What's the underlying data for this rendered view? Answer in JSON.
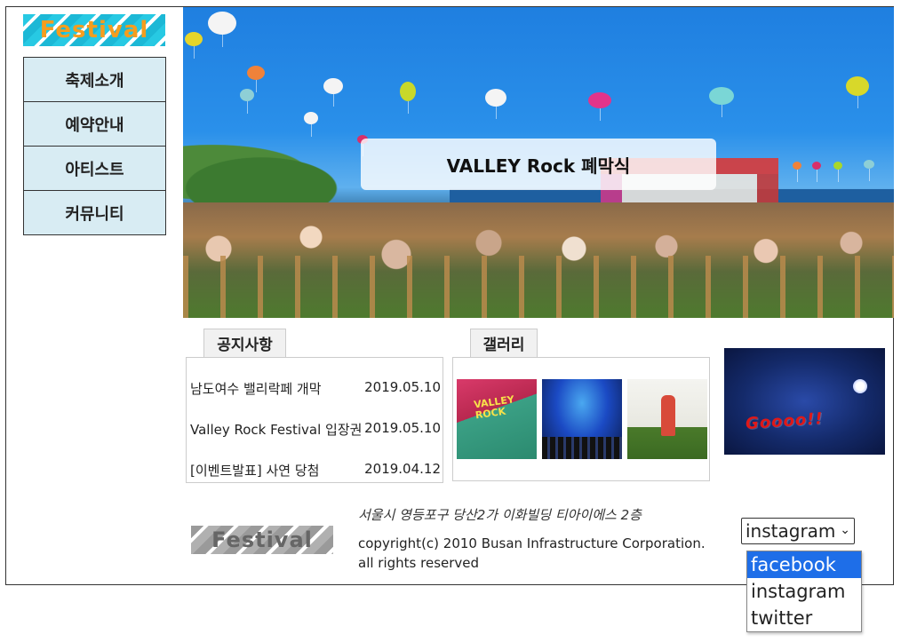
{
  "logo": {
    "text": "Festival"
  },
  "nav": {
    "items": [
      "축제소개",
      "예약안내",
      "아티스트",
      "커뮤니티"
    ]
  },
  "hero": {
    "title": "VALLEY Rock 폐막식"
  },
  "notice": {
    "tab_label": "공지사항",
    "items": [
      {
        "title": "남도여수 밸리락페 개막",
        "date": "2019.05.10"
      },
      {
        "title": "Valley Rock Festival 입장권",
        "date": "2019.05.10"
      },
      {
        "title": "[이벤트발표] 사연 당첨",
        "date": "2019.04.12"
      }
    ]
  },
  "gallery": {
    "tab_label": "갤러리"
  },
  "promo": {
    "text": "Goooo!!"
  },
  "footer": {
    "logo_text": "Festival",
    "address": "서울시 영등포구 당산2가 이화빌딩 티아이에스 2층",
    "copyright": "copyright(c) 2010 Busan Infrastructure Corporation.",
    "rights": "all rights reserved"
  },
  "sns": {
    "selected": "instagram",
    "options": [
      "facebook",
      "instagram",
      "twitter"
    ],
    "highlighted": "facebook"
  },
  "colors": {
    "logo_text": "#f59d1e",
    "logo_stripe": "#27c9e3",
    "nav_bg": "#d8ecf3",
    "select_highlight": "#1e6ee8"
  }
}
